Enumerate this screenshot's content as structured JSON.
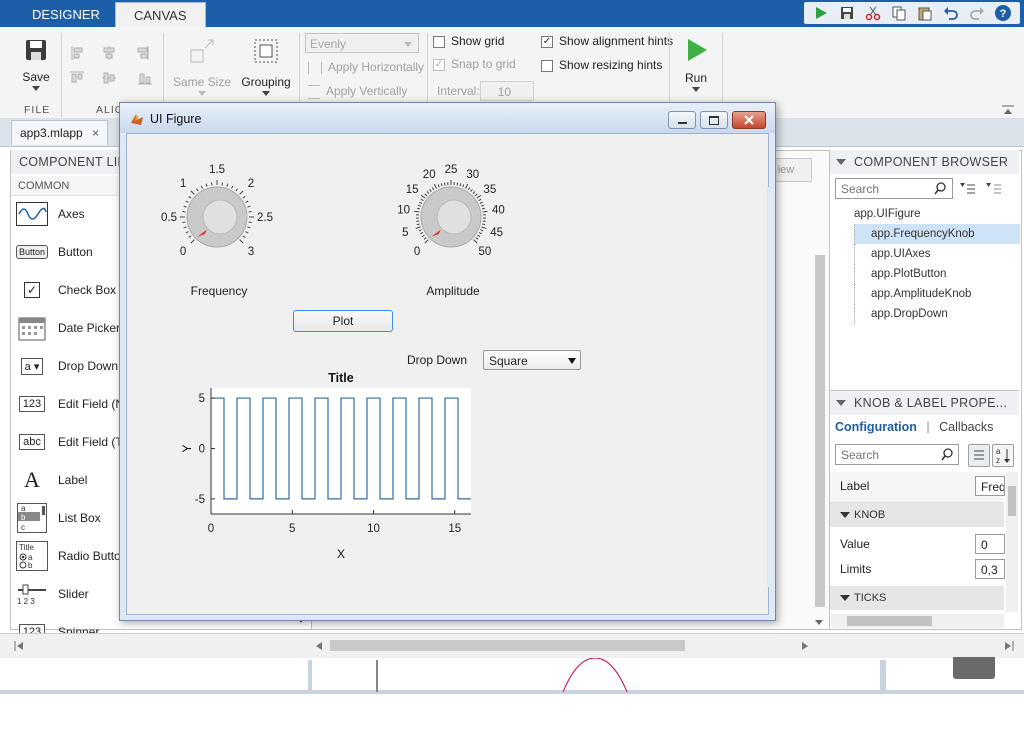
{
  "tabs": {
    "designer": "DESIGNER",
    "canvas": "CANVAS"
  },
  "toolbar_icons": [
    "run-icon",
    "save-icon",
    "cut-icon",
    "copy-icon",
    "paste-icon",
    "undo-icon",
    "redo-icon",
    "help-icon"
  ],
  "ribbon": {
    "save_label": "Save",
    "same_size_label": "Same Size",
    "grouping_label": "Grouping",
    "evenly_value": "Evenly",
    "apply_horizontally": "Apply Horizontally",
    "apply_vertically": "Apply Vertically",
    "show_grid": "Show grid",
    "snap_to_grid": "Snap to grid",
    "interval_label": "Interval:",
    "interval_value": "10",
    "show_alignment_hints": "Show alignment hints",
    "show_resizing_hints": "Show resizing hints",
    "run_label": "Run",
    "section_file": "FILE",
    "section_align": "ALIG",
    "show_grid_checked": false,
    "snap_to_grid_checked": true,
    "show_alignment_hints_checked": true,
    "show_resizing_hints_checked": false
  },
  "doc_tab": {
    "label": "app3.mlapp",
    "close": "×"
  },
  "component_library": {
    "title": "COMPONENT LIBI",
    "section": "COMMON",
    "items": [
      {
        "label": "Axes",
        "icon": "axes-icon"
      },
      {
        "label": "Button",
        "icon": "button-icon",
        "icon_text": "Button"
      },
      {
        "label": "Check Box",
        "icon": "checkbox-icon",
        "icon_text": "✓"
      },
      {
        "label": "Date Picker",
        "icon": "calendar-icon"
      },
      {
        "label": "Drop Down",
        "icon": "dropdown-icon",
        "icon_text": "a ▾"
      },
      {
        "label": "Edit Field (N",
        "icon": "numeric-field-icon",
        "icon_text": "123"
      },
      {
        "label": "Edit Field (T",
        "icon": "text-field-icon",
        "icon_text": "abc"
      },
      {
        "label": "Label",
        "icon": "label-icon",
        "icon_text": "A"
      },
      {
        "label": "List Box",
        "icon": "listbox-icon"
      },
      {
        "label": "Radio Butto",
        "icon": "radio-icon"
      },
      {
        "label": "Slider",
        "icon": "slider-icon"
      },
      {
        "label": "Spinner",
        "icon": "spinner-icon",
        "icon_text": "123"
      }
    ]
  },
  "canvas_view_btn": "iew",
  "ui_figure": {
    "title": "UI Figure",
    "frequency_knob": {
      "label": "Frequency",
      "ticks": [
        "0",
        "0.5",
        "1",
        "1.5",
        "2",
        "2.5",
        "3"
      ],
      "value": 0
    },
    "amplitude_knob": {
      "label": "Amplitude",
      "ticks": [
        "0",
        "5",
        "10",
        "15",
        "20",
        "25",
        "30",
        "35",
        "40",
        "45",
        "50"
      ],
      "value": 0
    },
    "plot_button": "Plot",
    "dropdown": {
      "label": "Drop Down",
      "value": "Square"
    }
  },
  "chart_data": {
    "type": "line",
    "title": "Title",
    "xlabel": "X",
    "ylabel": "Y",
    "xlim": [
      0,
      16
    ],
    "ylim": [
      -6.5,
      6
    ],
    "xticks": [
      0,
      5,
      10,
      15
    ],
    "yticks": [
      -5,
      0,
      5
    ],
    "series": [
      {
        "wave": "square",
        "amplitude": 5,
        "period": 1.6,
        "x_start": 0,
        "x_end": 16
      }
    ],
    "color": "#2f6f9f",
    "grid": false
  },
  "component_browser": {
    "title": "COMPONENT BROWSER",
    "search_placeholder": "Search",
    "items": [
      "app.UIFigure",
      "app.FrequencyKnob",
      "app.UIAxes",
      "app.PlotButton",
      "app.AmplitudeKnob",
      "app.DropDown"
    ],
    "selected": "app.FrequencyKnob"
  },
  "properties": {
    "title": "KNOB & LABEL PROPE...",
    "tab_config": "Configuration",
    "tab_separator": "|",
    "tab_callbacks": "Callbacks",
    "search_placeholder": "Search",
    "label_name": "Label",
    "label_value": "Freq",
    "section_knob": "KNOB",
    "value_name": "Value",
    "value_value": "0",
    "limits_name": "Limits",
    "limits_value": "0,3",
    "section_ticks": "TICKS"
  }
}
